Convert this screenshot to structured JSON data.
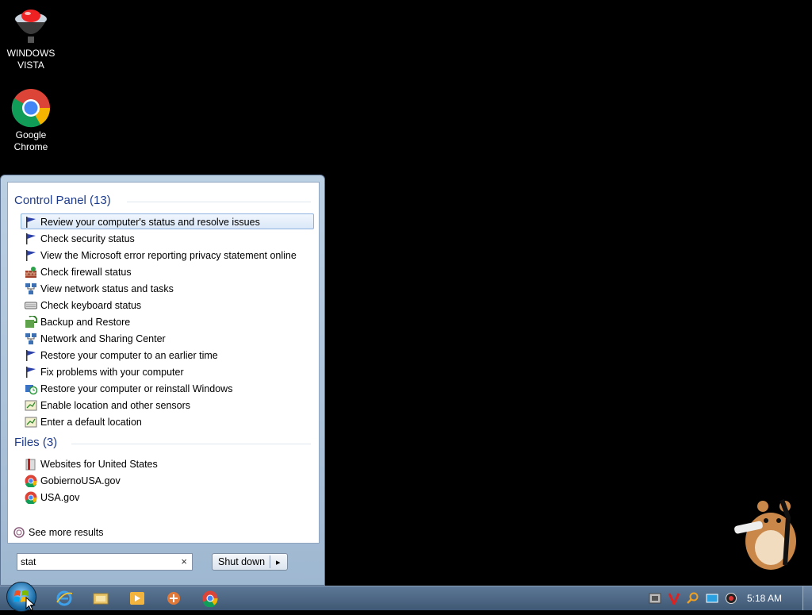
{
  "desktop": {
    "icons": [
      {
        "label": "WINDOWS\nVISTA",
        "icon": "vista-icon"
      },
      {
        "label": "Google\nChrome",
        "icon": "chrome-icon"
      }
    ]
  },
  "start_menu": {
    "groups": [
      {
        "title": "Control Panel (13)",
        "items": [
          {
            "label": "Review your computer's status and resolve issues",
            "icon": "flag-icon",
            "selected": true
          },
          {
            "label": "Check security status",
            "icon": "flag-icon"
          },
          {
            "label": "View the Microsoft error reporting privacy statement online",
            "icon": "flag-icon"
          },
          {
            "label": "Check firewall status",
            "icon": "firewall-icon"
          },
          {
            "label": "View network status and tasks",
            "icon": "network-icon"
          },
          {
            "label": "Check keyboard status",
            "icon": "keyboard-icon"
          },
          {
            "label": "Backup and Restore",
            "icon": "backup-icon"
          },
          {
            "label": "Network and Sharing Center",
            "icon": "network-icon"
          },
          {
            "label": "Restore your computer to an earlier time",
            "icon": "flag-icon"
          },
          {
            "label": "Fix problems with your computer",
            "icon": "flag-icon"
          },
          {
            "label": "Restore your computer or reinstall Windows",
            "icon": "restore-icon"
          },
          {
            "label": "Enable location and other sensors",
            "icon": "sensor-icon"
          },
          {
            "label": "Enter a default location",
            "icon": "sensor-icon"
          }
        ]
      },
      {
        "title": "Files (3)",
        "items": [
          {
            "label": "Websites for United States",
            "icon": "folder-icon"
          },
          {
            "label": "GobiernoUSA.gov",
            "icon": "chrome-icon"
          },
          {
            "label": "USA.gov",
            "icon": "chrome-icon"
          }
        ]
      }
    ],
    "see_more": "See more results",
    "search": {
      "value": "stat",
      "clear": "×"
    },
    "shutdown_label": "Shut down",
    "shutdown_arrow": "▸"
  },
  "taskbar": {
    "pinned": [
      "ie-icon",
      "explorer-icon",
      "media-player-icon",
      "app-icon",
      "chrome-icon"
    ],
    "clock": "5:18 AM"
  }
}
